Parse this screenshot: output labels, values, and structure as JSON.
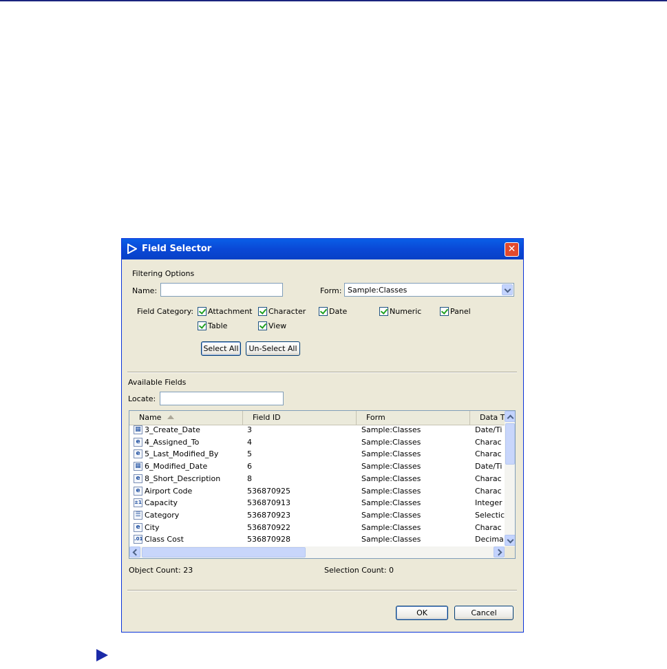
{
  "dialog": {
    "title": "Field Selector",
    "filtering_title": "Filtering Options",
    "name_label": "Name:",
    "name_value": "",
    "form_label": "Form:",
    "form_value": "Sample:Classes",
    "field_category_label": "Field Category:",
    "categories": [
      {
        "label": "Attachment",
        "checked": true
      },
      {
        "label": "Character",
        "checked": true
      },
      {
        "label": "Date",
        "checked": true
      },
      {
        "label": "Numeric",
        "checked": true
      },
      {
        "label": "Panel",
        "checked": true
      },
      {
        "label": "Table",
        "checked": true
      },
      {
        "label": "View",
        "checked": true
      }
    ],
    "select_all": "Select All",
    "unselect_all": "Un-Select All",
    "available_fields_title": "Available Fields",
    "locate_label": "Locate:",
    "locate_value": "",
    "columns": [
      "Name",
      "Field ID",
      "Form",
      "Data T"
    ],
    "rows": [
      {
        "icon": "date",
        "name": "3_Create_Date",
        "id": "3",
        "form": "Sample:Classes",
        "type": "Date/Ti"
      },
      {
        "icon": "char",
        "name": "4_Assigned_To",
        "id": "4",
        "form": "Sample:Classes",
        "type": "Charac"
      },
      {
        "icon": "char",
        "name": "5_Last_Modified_By",
        "id": "5",
        "form": "Sample:Classes",
        "type": "Charac"
      },
      {
        "icon": "date",
        "name": "6_Modified_Date",
        "id": "6",
        "form": "Sample:Classes",
        "type": "Date/Ti"
      },
      {
        "icon": "char",
        "name": "8_Short_Description",
        "id": "8",
        "form": "Sample:Classes",
        "type": "Charac"
      },
      {
        "icon": "char",
        "name": "Airport Code",
        "id": "536870925",
        "form": "Sample:Classes",
        "type": "Charac"
      },
      {
        "icon": "int",
        "name": "Capacity",
        "id": "536870913",
        "form": "Sample:Classes",
        "type": "Integer"
      },
      {
        "icon": "select",
        "name": "Category",
        "id": "536870923",
        "form": "Sample:Classes",
        "type": "Selectic"
      },
      {
        "icon": "char",
        "name": "City",
        "id": "536870922",
        "form": "Sample:Classes",
        "type": "Charac"
      },
      {
        "icon": "decimal",
        "name": "Class Cost",
        "id": "536870928",
        "form": "Sample:Classes",
        "type": "Decima"
      }
    ],
    "object_count": "Object Count: 23",
    "selection_count": "Selection Count: 0",
    "ok": "OK",
    "cancel": "Cancel"
  },
  "icon_glyphs": {
    "char": "e",
    "date": "▦",
    "int": "±1",
    "select": "☰",
    "decimal": ".01"
  },
  "colors": {
    "titlebar": "#0a5fe7",
    "dialog_bg": "#ece9d8",
    "accent": "#1a2aa8"
  }
}
